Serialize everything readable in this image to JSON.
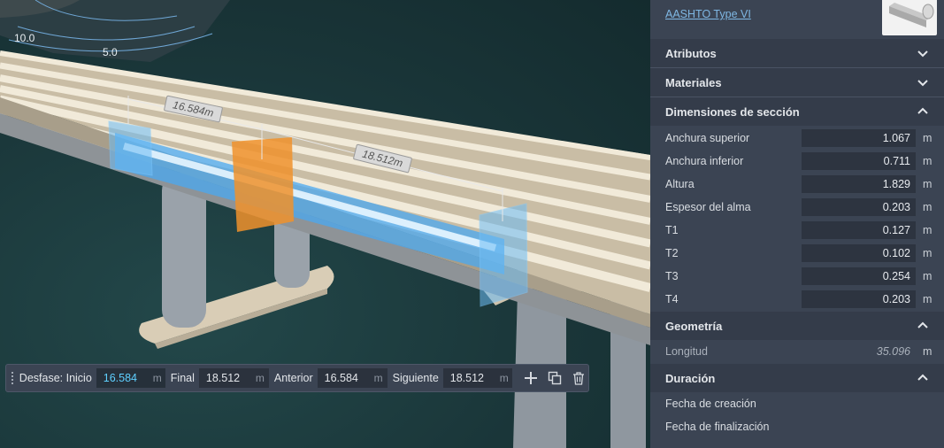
{
  "viewport": {
    "contours": [
      "10.0",
      "5.0"
    ],
    "dimension_labels": [
      "16.584m",
      "18.512m"
    ]
  },
  "toolbar": {
    "offset_start_label": "Desfase: Inicio",
    "offset_start_value": "16.584",
    "final_label": "Final",
    "final_value": "18.512",
    "previous_label": "Anterior",
    "previous_value": "16.584",
    "next_label": "Siguiente",
    "next_value": "18.512",
    "unit": "m",
    "icons": [
      "plus-icon",
      "copy-icon",
      "trash-icon"
    ]
  },
  "panel": {
    "component_link": "AASHTO Type VI",
    "sections": {
      "attributes": "Atributos",
      "materials": "Materiales",
      "section_dims": "Dimensiones de sección",
      "geometry": "Geometría",
      "duration": "Duración"
    },
    "unit": "m",
    "dims": [
      {
        "label": "Anchura superior",
        "value": "1.067"
      },
      {
        "label": "Anchura inferior",
        "value": "0.711"
      },
      {
        "label": "Altura",
        "value": "1.829"
      },
      {
        "label": "Espesor del alma",
        "value": "0.203"
      },
      {
        "label": "T1",
        "value": "0.127"
      },
      {
        "label": "T2",
        "value": "0.102"
      },
      {
        "label": "T3",
        "value": "0.254"
      },
      {
        "label": "T4",
        "value": "0.203"
      }
    ],
    "geometry": {
      "length_label": "Longitud",
      "length_value": "35.096"
    },
    "duration": {
      "created_label": "Fecha de creación",
      "finished_label": "Fecha de finalización"
    }
  },
  "colors": {
    "panel_bg": "#3b4453",
    "section_bg": "#343c4a",
    "link": "#7fb7e3",
    "accent_input": "#5fd0ff",
    "beam_blue": "#4aa8f0",
    "beam_orange": "#f0922c"
  }
}
